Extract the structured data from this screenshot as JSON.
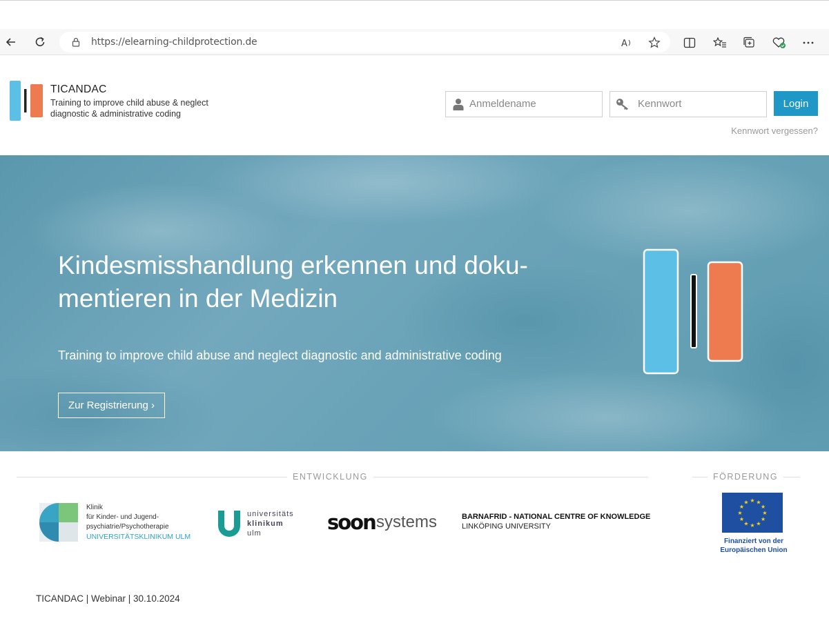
{
  "browser": {
    "url": "https://elearning-childprotection.de",
    "icons": [
      "back-icon",
      "reload-icon",
      "lock-icon",
      "read-aloud-icon",
      "favorite-star-icon",
      "split-screen-icon",
      "favorites-icon",
      "collections-icon",
      "browser-essentials-icon",
      "more-icon"
    ]
  },
  "header": {
    "brand_title": "TICANDAC",
    "brand_subtitle": "Training to improve child abuse & neglect diagnostic & administrative coding",
    "username_placeholder": "Anmeldename",
    "password_placeholder": "Kennwort",
    "login_label": "Login",
    "forgot_label": "Kennwort vergessen?",
    "login_button_color": "#1f98c8"
  },
  "hero": {
    "title": "Kindesmisshandlung erkennen und doku-mentieren in der Medizin",
    "title_line1": "Kindesmisshandlung erkennen und doku-",
    "title_line2": "mentieren in der Medizin",
    "subtitle": "Training to improve child abuse and neglect diagnostic and administrative coding",
    "register_label": "Zur Registrierung ›",
    "colors": {
      "blue_bar": "#5bbfe6",
      "orange_bar": "#ee7b4f"
    }
  },
  "partners": {
    "development_label": "ENTWICKLUNG",
    "funding_label": "FÖRDERUNG",
    "ulm_clinic": {
      "line1": "Klinik",
      "line2": "für Kinder- und Jugend-",
      "line3": "psychiatrie/Psychotherapie",
      "line4": "UNIVERSITÄTSKLINIKUM ULM"
    },
    "uk_ulm": {
      "line1": "universitäts",
      "line2": "klinikum",
      "line3": "ulm"
    },
    "soon": {
      "part1": "soon",
      "part2": "systems"
    },
    "barnafrid": {
      "line1": "BARNAFRID - NATIONAL CENTRE OF KNOWLEDGE",
      "line2": "LINKÖPING UNIVERSITY"
    },
    "eu": {
      "line1": "Finanziert von der",
      "line2": "Europäischen Union"
    }
  },
  "footer": {
    "note": "TICANDAC | Webinar | 30.10.2024"
  }
}
